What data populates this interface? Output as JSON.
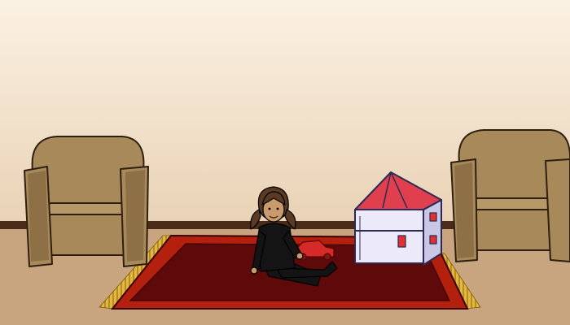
{
  "scene": {
    "kind": "illustration",
    "objects": [
      "left-armchair",
      "right-armchair",
      "rug",
      "girl",
      "toy-car",
      "dollhouse"
    ]
  },
  "colors": {
    "wall_top": "#fbf1e3",
    "wall_bottom": "#e9d2b5",
    "baseboard": "#4a2a18",
    "floor": "#c9a57f",
    "armchair": "#a88a5a",
    "armchair_shadow": "#8d7045",
    "rug_border": "#b3200e",
    "rug_field": "#5e0a0a",
    "rug_fringe": "#d3a833",
    "girl_outfit": "#141414",
    "girl_skin": "#c99a6c",
    "girl_hair": "#5a3a22",
    "toy_car": "#d42a2a",
    "dollhouse_roof": "#e0404e",
    "dollhouse_wall": "#eceaf8",
    "dollhouse_windows": "#e23030"
  }
}
